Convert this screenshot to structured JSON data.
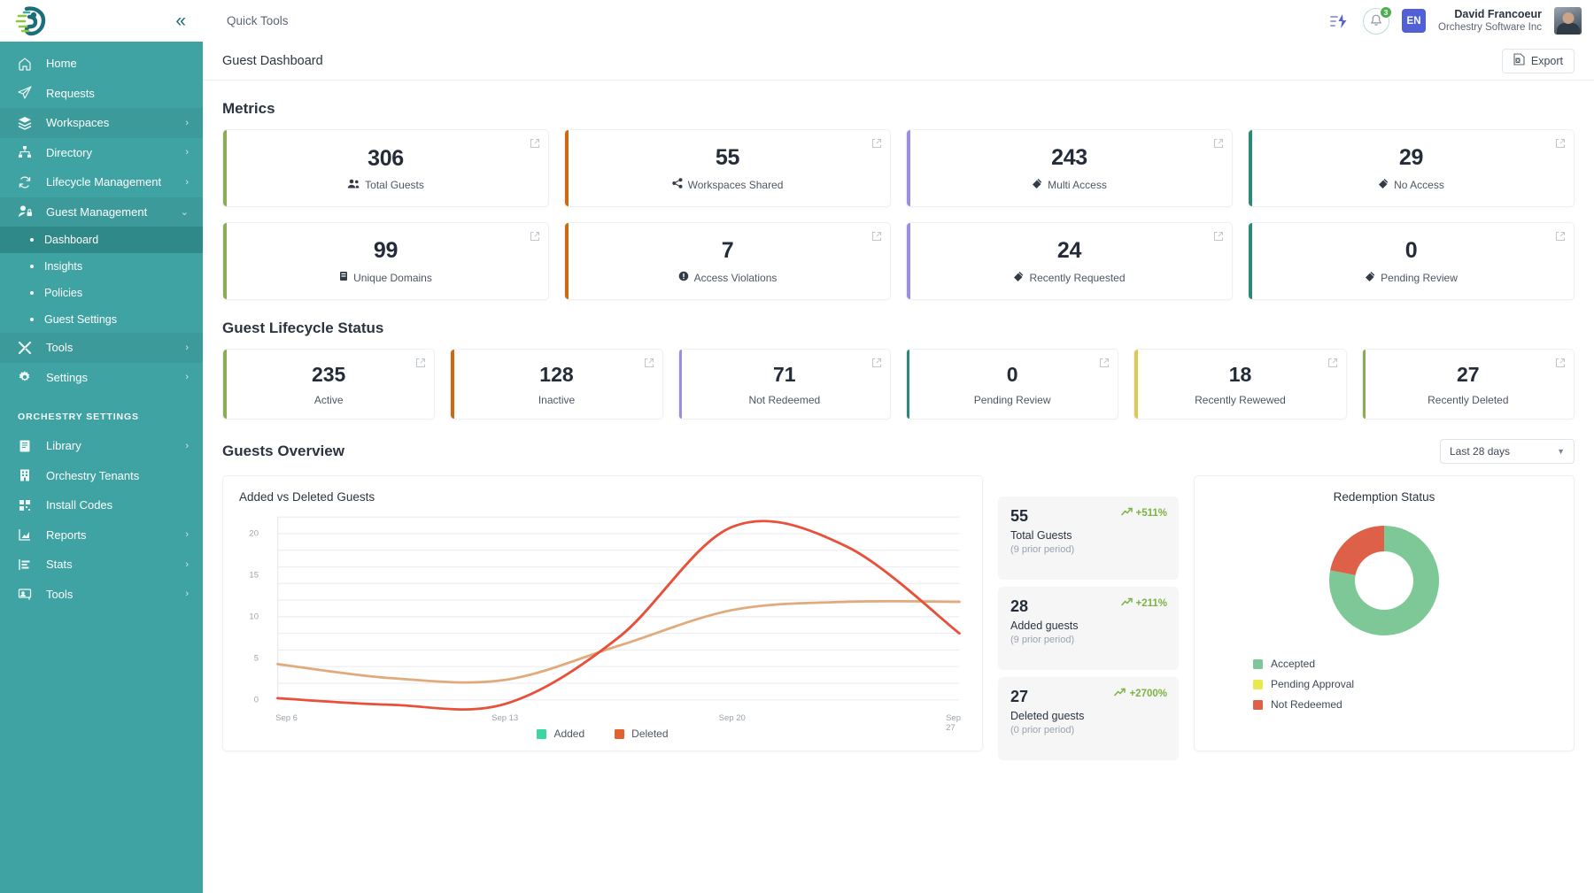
{
  "topbar": {
    "quick_tools": "Quick Tools",
    "lang": "EN",
    "notifications_count": "3",
    "user_name": "David Francoeur",
    "user_org": "Orchestry Software Inc"
  },
  "page": {
    "title": "Guest Dashboard",
    "export_label": "Export"
  },
  "sidebar": {
    "items": [
      {
        "label": "Home",
        "icon": "home-icon",
        "chevron": false
      },
      {
        "label": "Requests",
        "icon": "send-icon",
        "chevron": false
      },
      {
        "label": "Workspaces",
        "icon": "layers-icon",
        "chevron": true
      },
      {
        "label": "Directory",
        "icon": "sitemap-icon",
        "chevron": true
      },
      {
        "label": "Lifecycle Management",
        "icon": "refresh-icon",
        "chevron": true
      },
      {
        "label": "Guest Management",
        "icon": "user-lock-icon",
        "chevron": true,
        "expanded": true
      }
    ],
    "sub_items": [
      {
        "label": "Dashboard",
        "active": true
      },
      {
        "label": "Insights",
        "active": false
      },
      {
        "label": "Policies",
        "active": false
      },
      {
        "label": "Guest Settings",
        "active": false
      }
    ],
    "items_after": [
      {
        "label": "Tools",
        "icon": "tools-icon",
        "chevron": true
      },
      {
        "label": "Settings",
        "icon": "gear-icon",
        "chevron": true
      }
    ],
    "section_label": "ORCHESTRY SETTINGS",
    "settings_items": [
      {
        "label": "Library",
        "icon": "book-icon",
        "chevron": true
      },
      {
        "label": "Orchestry Tenants",
        "icon": "building-icon",
        "chevron": false
      },
      {
        "label": "Install Codes",
        "icon": "qr-icon",
        "chevron": false
      },
      {
        "label": "Reports",
        "icon": "report-chart-icon",
        "chevron": true
      },
      {
        "label": "Stats",
        "icon": "stats-bar-icon",
        "chevron": true
      },
      {
        "label": "Tools",
        "icon": "screen-user-icon",
        "chevron": true
      }
    ]
  },
  "metrics": {
    "title": "Metrics",
    "cards": [
      {
        "value": "306",
        "label": "Total Guests",
        "icon": "users-icon",
        "color": "#8aac52"
      },
      {
        "value": "55",
        "label": "Workspaces Shared",
        "icon": "share-icon",
        "color": "#cc6a11"
      },
      {
        "value": "243",
        "label": "Multi Access",
        "icon": "key-icon",
        "color": "#9b8ee0"
      },
      {
        "value": "29",
        "label": "No Access",
        "icon": "key-icon",
        "color": "#2e8878"
      },
      {
        "value": "99",
        "label": "Unique Domains",
        "icon": "server-icon",
        "color": "#8aac52"
      },
      {
        "value": "7",
        "label": "Access Violations",
        "icon": "alert-icon",
        "color": "#cc6a11"
      },
      {
        "value": "24",
        "label": "Recently Requested",
        "icon": "key-icon",
        "color": "#9b8ee0"
      },
      {
        "value": "0",
        "label": "Pending Review",
        "icon": "key-icon",
        "color": "#2e8878"
      }
    ]
  },
  "lifecycle": {
    "title": "Guest Lifecycle Status",
    "cards": [
      {
        "value": "235",
        "label": "Active",
        "color": "#8aac52"
      },
      {
        "value": "128",
        "label": "Inactive",
        "color": "#cc6a11"
      },
      {
        "value": "71",
        "label": "Not Redeemed",
        "color": "#9b8ee0"
      },
      {
        "value": "0",
        "label": "Pending Review",
        "color": "#2e8878"
      },
      {
        "value": "18",
        "label": "Recently Rewewed",
        "color": "#ddc94f"
      },
      {
        "value": "27",
        "label": "Recently Deleted",
        "color": "#8aac52"
      }
    ]
  },
  "overview": {
    "title": "Guests Overview",
    "range_value": "Last 28 days",
    "stats": [
      {
        "value": "55",
        "label": "Total Guests",
        "sub": "(9 prior period)",
        "delta": "+511%"
      },
      {
        "value": "28",
        "label": "Added guests",
        "sub": "(9 prior period)",
        "delta": "+211%"
      },
      {
        "value": "27",
        "label": "Deleted guests",
        "sub": "(0 prior period)",
        "delta": "+2700%"
      }
    ]
  },
  "chart_data": [
    {
      "type": "line",
      "title": "Added vs Deleted Guests",
      "xlabel": "",
      "ylabel": "",
      "ylim": [
        0,
        22
      ],
      "yticks": [
        0,
        5,
        10,
        15,
        20
      ],
      "grid": true,
      "legend_position": "bottom",
      "x": [
        "Sep 6",
        "Sep 9",
        "Sep 13",
        "Sep 16",
        "Sep 20",
        "Sep 23",
        "Sep 27"
      ],
      "xtick_labels": [
        "Sep 6",
        "Sep 13",
        "Sep 20",
        "Sep 27"
      ],
      "series": [
        {
          "name": "Added",
          "color": "#e0ab7c",
          "values": [
            4.3,
            2.6,
            2.4,
            6.5,
            10.8,
            11.8,
            11.8
          ]
        },
        {
          "name": "Deleted",
          "color": "#e8503a",
          "values": [
            0.2,
            -0.6,
            -0.5,
            7.5,
            20.8,
            18.5,
            8.0
          ]
        }
      ]
    },
    {
      "type": "pie",
      "title": "Redemption Status",
      "donut": true,
      "legend_position": "bottom-left",
      "labels": [
        "Accepted",
        "Pending Approval",
        "Not Redeemed"
      ],
      "values": [
        78,
        0,
        22
      ],
      "colors": [
        "#7dc896",
        "#e9e94e",
        "#df6048"
      ]
    }
  ]
}
